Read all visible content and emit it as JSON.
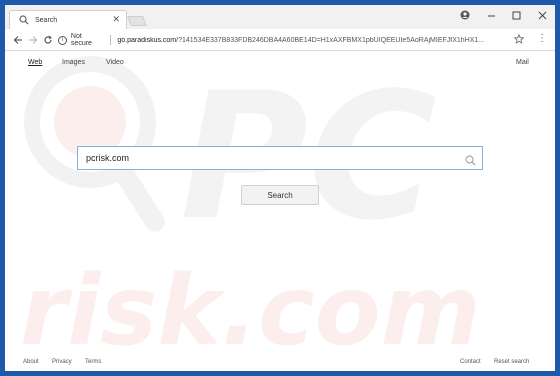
{
  "browser": {
    "tab": {
      "title": "Search"
    },
    "address_bar": {
      "security_label": "Not secure",
      "host": "go.paradiskus.com",
      "path": "/?141534E337B833FDB246DBA4A60BE14D=H1xAXFBMX1pbUIQEEUIe5AoRAjMIEFJfX1hHX1..."
    }
  },
  "page": {
    "nav": {
      "web": "Web",
      "images": "Images",
      "video": "Video",
      "mail": "Mail"
    },
    "search": {
      "value": "pcrisk.com",
      "button_label": "Search"
    },
    "footer": {
      "about": "About",
      "privacy": "Privacy",
      "terms": "Terms",
      "contact": "Contact",
      "reset": "Reset search"
    },
    "watermark": {
      "line1": "PC",
      "line2": "risk.com"
    }
  },
  "colors": {
    "frame": "#1f5aa8",
    "search_border": "#7fb3ea",
    "watermark_red": "#e8503a"
  }
}
